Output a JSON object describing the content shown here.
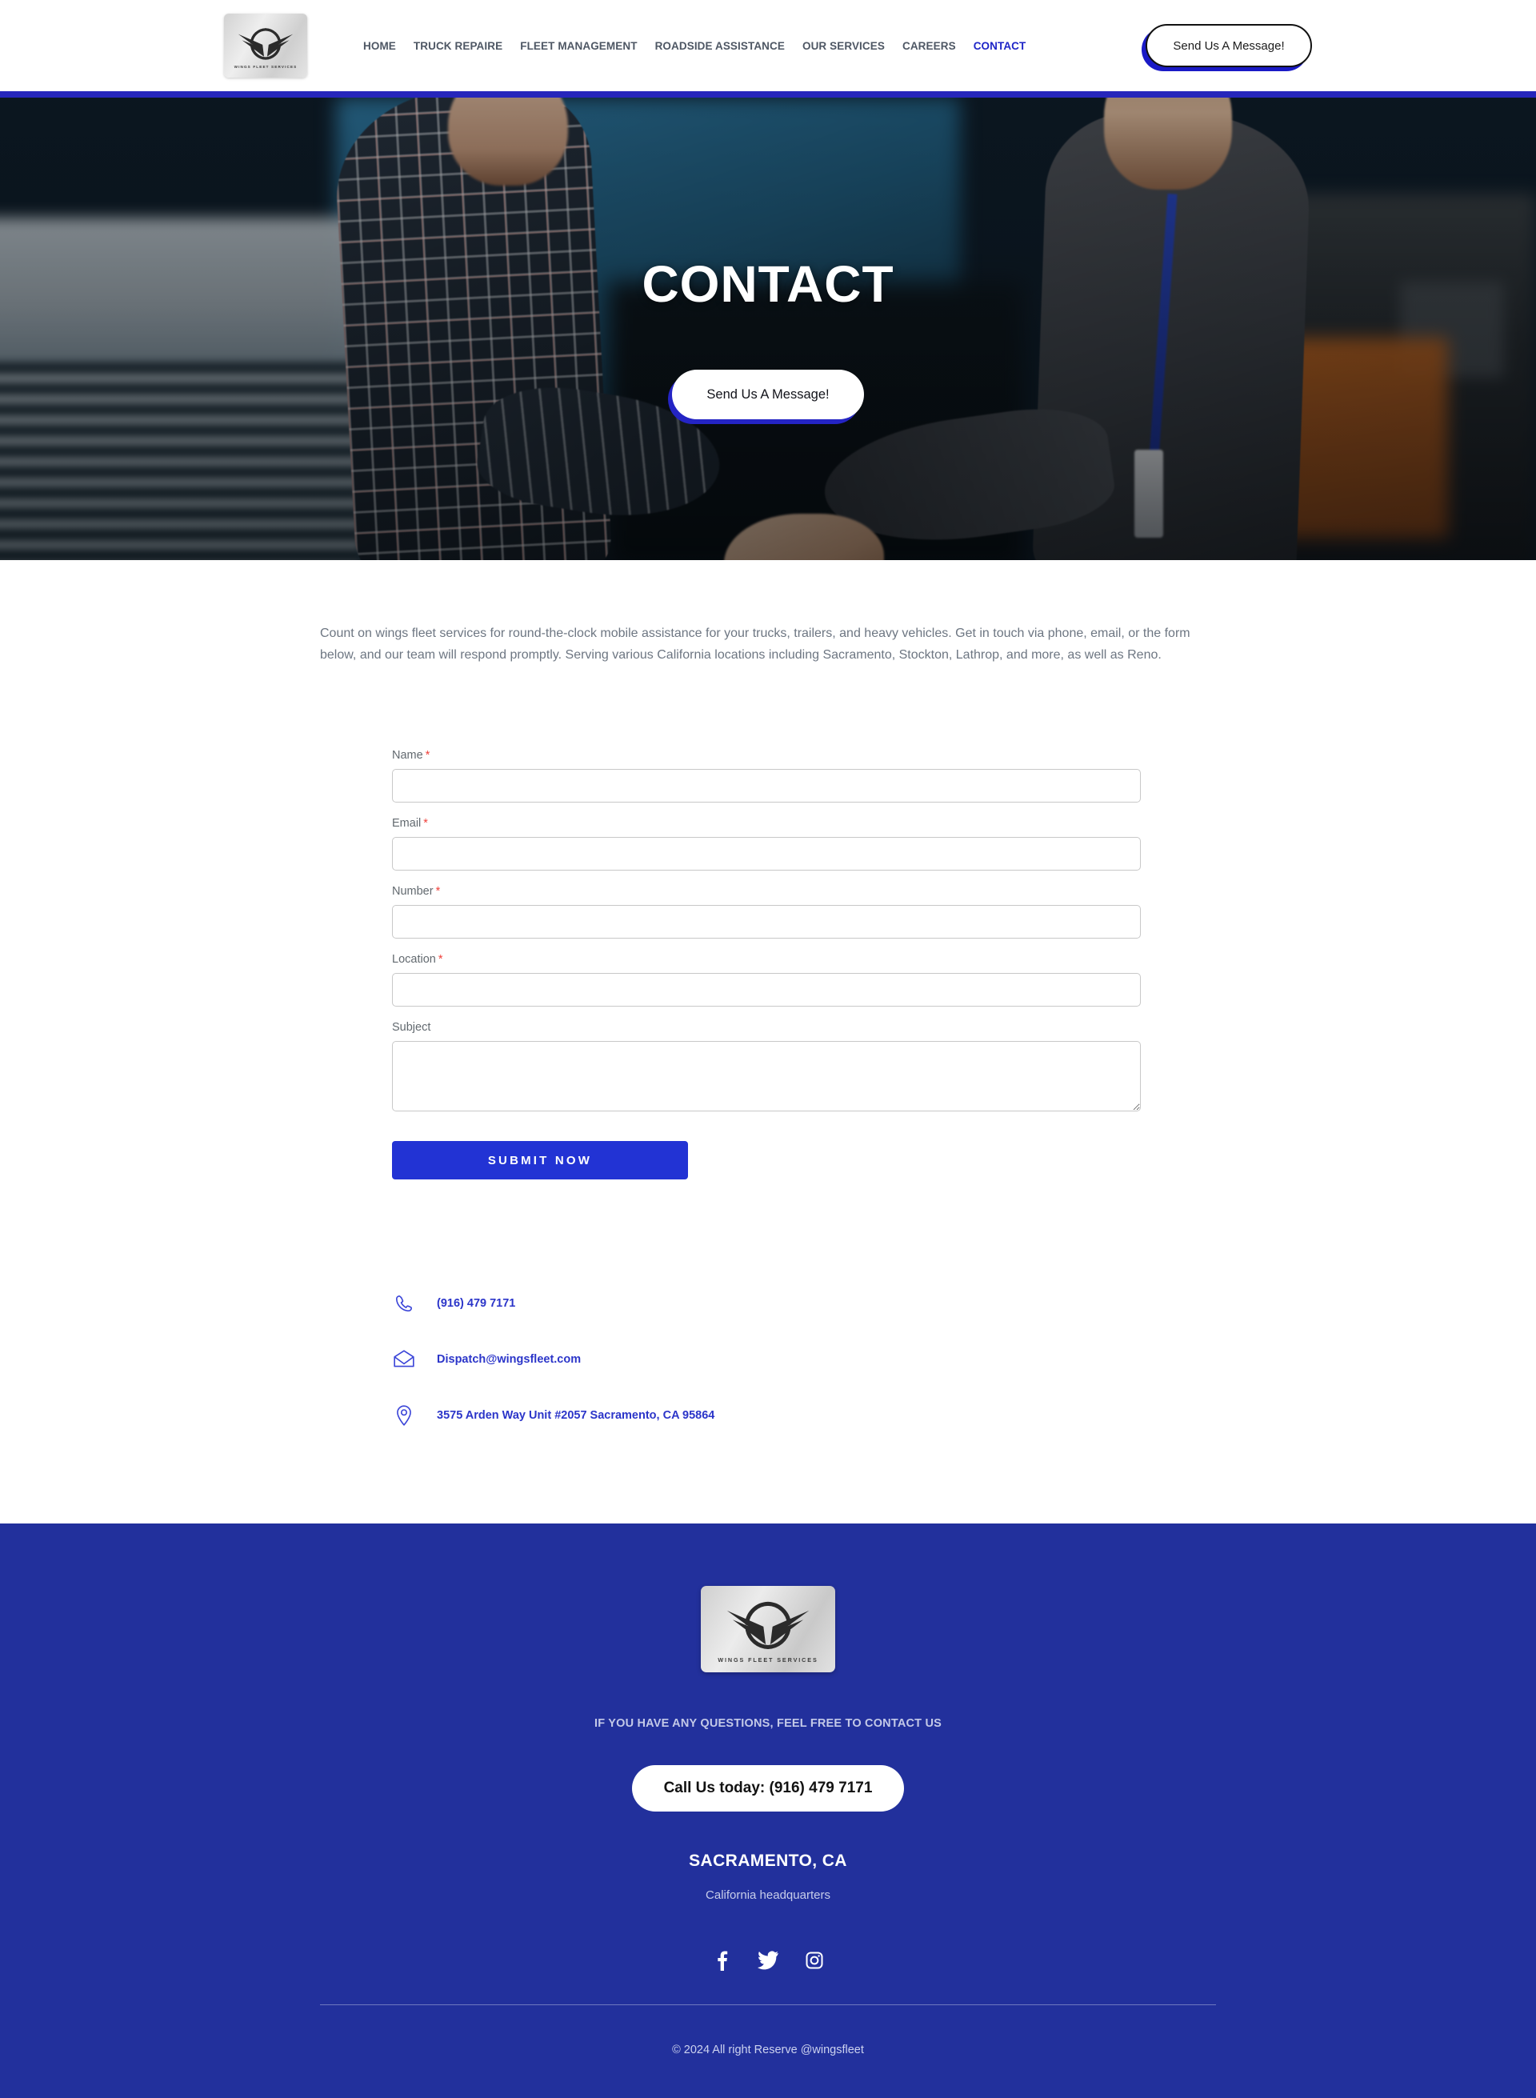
{
  "brand": {
    "logo_text": "WINGS FLEET SERVICES",
    "accent_color": "#2626bb",
    "footer_bg": "#22309c",
    "submit_color": "#2233d4",
    "link_color": "#2b35c9"
  },
  "header": {
    "nav": [
      {
        "label": "HOME",
        "active": false
      },
      {
        "label": "TRUCK REPAIRE",
        "active": false
      },
      {
        "label": "FLEET MANAGEMENT",
        "active": false
      },
      {
        "label": "ROADSIDE ASSISTANCE",
        "active": false
      },
      {
        "label": "OUR SERVICES",
        "active": false
      },
      {
        "label": "CAREERS",
        "active": false
      },
      {
        "label": "CONTACT",
        "active": true
      }
    ],
    "cta_label": "Send Us A Message!"
  },
  "hero": {
    "title": "CONTACT",
    "cta_label": "Send Us A Message!"
  },
  "main": {
    "intro": "Count on wings fleet services for round-the-clock mobile assistance for your trucks, trailers, and heavy vehicles. Get in touch via phone, email, or the form below, and our team will respond promptly. Serving various California locations including Sacramento, Stockton, Lathrop, and more, as well as Reno."
  },
  "form": {
    "fields": [
      {
        "label": "Name",
        "required": true,
        "type": "text",
        "value": "",
        "placeholder": ""
      },
      {
        "label": "Email",
        "required": true,
        "type": "text",
        "value": "",
        "placeholder": ""
      },
      {
        "label": "Number",
        "required": true,
        "type": "text",
        "value": "",
        "placeholder": ""
      },
      {
        "label": "Location",
        "required": true,
        "type": "text",
        "value": "",
        "placeholder": ""
      },
      {
        "label": "Subject",
        "required": false,
        "type": "textarea",
        "value": "",
        "placeholder": ""
      }
    ],
    "required_mark": "*",
    "submit_label": "SUBMIT NOW"
  },
  "contact": {
    "phone": "(916) 479 7171",
    "email": "Dispatch@wingsfleet.com",
    "address": "3575 Arden Way Unit #2057 Sacramento, CA 95864"
  },
  "footer": {
    "logo_text": "WINGS FLEET SERVICES",
    "tagline": "IF YOU HAVE ANY QUESTIONS, FEEL FREE TO CONTACT US",
    "call_label": "Call Us today: (916) 479 7171",
    "city": "SACRAMENTO, CA",
    "subtitle": "California headquarters",
    "socials": [
      {
        "name": "facebook"
      },
      {
        "name": "twitter"
      },
      {
        "name": "instagram"
      }
    ],
    "copyright": "© 2024 All right Reserve @wingsfleet"
  }
}
